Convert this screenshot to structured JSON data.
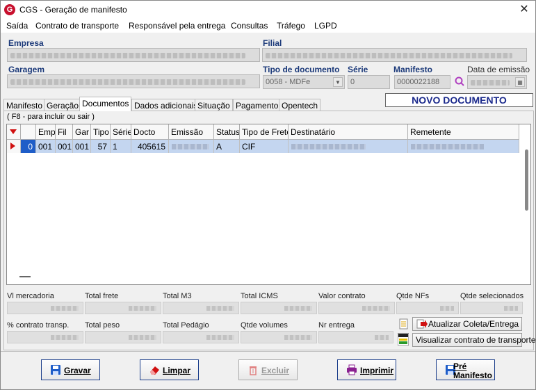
{
  "window": {
    "title": "CGS - Geração de manifesto",
    "close_label": "✕",
    "app_icon_letter": "G"
  },
  "menu": [
    "Saída",
    "Contrato de transporte",
    "Responsável pela entrega",
    "Consultas",
    "Tráfego",
    "LGPD"
  ],
  "form": {
    "empresa_label": "Empresa",
    "filial_label": "Filial",
    "garagem_label": "Garagem",
    "tipo_doc_label": "Tipo de documento",
    "tipo_doc_value": "0058 - MDFe",
    "serie_label": "Série",
    "serie_value": "0",
    "manifesto_label": "Manifesto",
    "manifesto_value": "0000022188",
    "data_emissao_label": "Data de emissão",
    "status_badge": "NOVO DOCUMENTO"
  },
  "tabs": [
    "Manifesto",
    "Geração",
    "Documentos",
    "Dados adicionais",
    "Situação",
    "Pagamento",
    "Opentech"
  ],
  "active_tab": "Documentos",
  "grid": {
    "hint": "( F8 - para incluir ou sair )",
    "columns": [
      "",
      "Emp",
      "Fil",
      "Gar",
      "Tipo",
      "Série",
      "Docto",
      "Emissão",
      "Status",
      "Tipo de Frete",
      "Destinatário",
      "Remetente"
    ],
    "rows": [
      {
        "seq": "0",
        "emp": "001",
        "fil": "001",
        "gar": "001",
        "tipo": "57",
        "serie": "1",
        "docto": "405615",
        "status": "A",
        "tipo_frete": "CIF"
      }
    ]
  },
  "totals": {
    "labels_row1": [
      "Vl mercadoria",
      "Total frete",
      "Total M3",
      "Total ICMS",
      "Valor contrato",
      "Qtde NFs",
      "Qtde selecionados"
    ],
    "labels_row2": [
      "% contrato transp.",
      "Total peso",
      "Total Pedágio",
      "Qtde volumes",
      "Nr entrega"
    ],
    "btn_atualizar": "Atualizar Coleta/Entrega",
    "btn_visualizar": "Visualizar contrato de transporte"
  },
  "buttons": {
    "gravar": "Gravar",
    "limpar": "Limpar",
    "excluir": "Excluir",
    "imprimir": "Imprimir",
    "pre_manifesto_1": "Pré",
    "pre_manifesto_2": "Manifesto"
  },
  "colors": {
    "accent": "#1b2a8c",
    "label_blue": "#1c3a7a",
    "selected_row": "#c4d6f0",
    "brand_red": "#c8102e"
  }
}
